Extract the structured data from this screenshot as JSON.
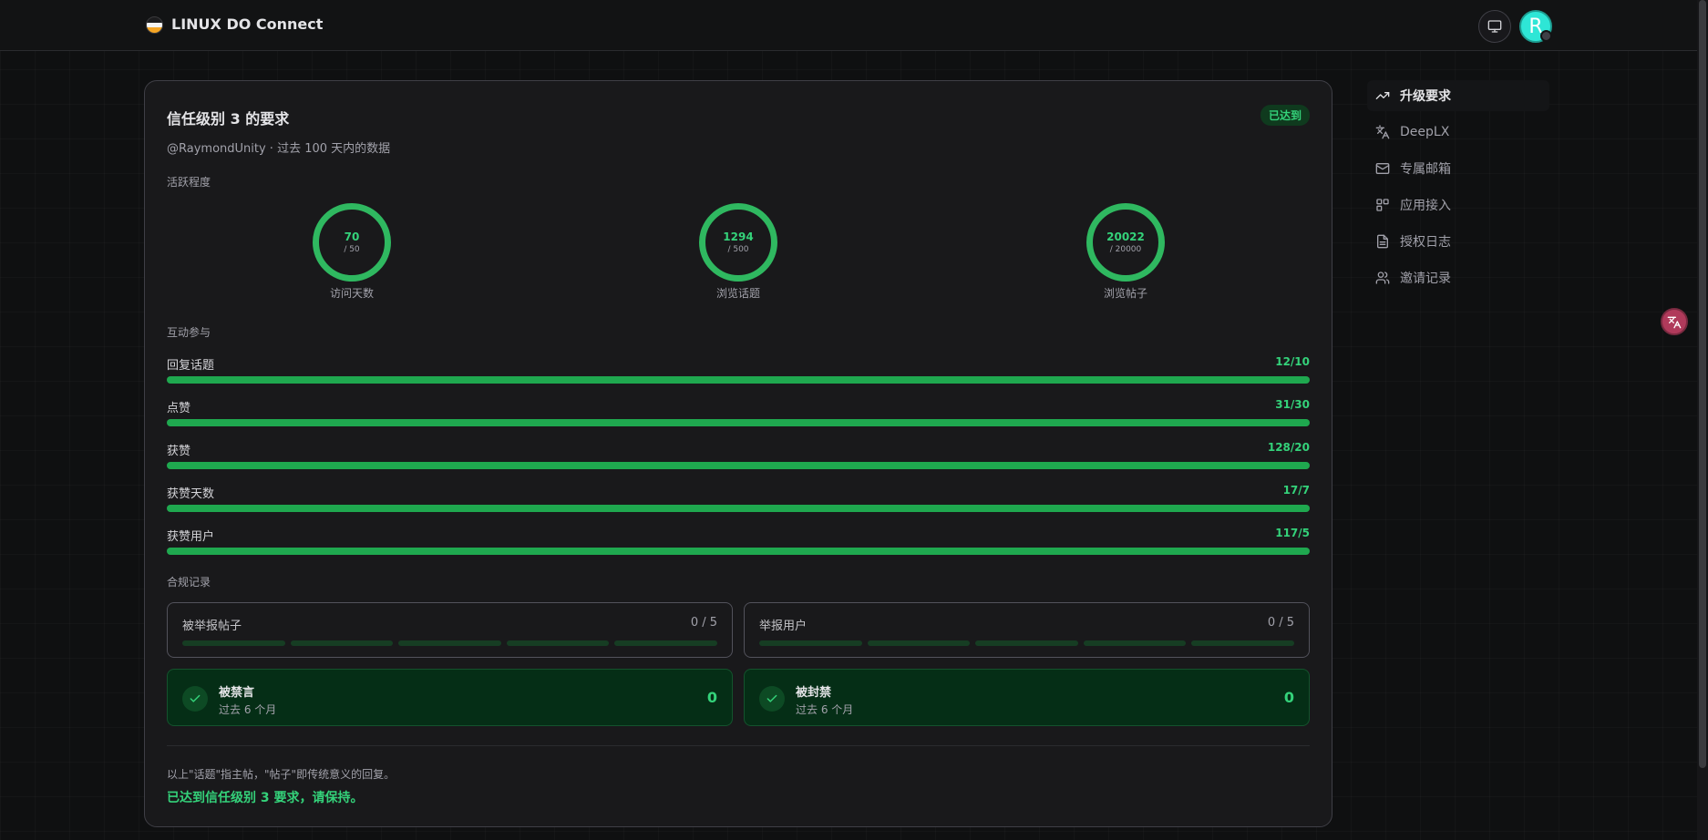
{
  "header": {
    "brand": "LINUX DO Connect",
    "avatar_letter": "R"
  },
  "card": {
    "title": "信任级别 3 的要求",
    "badge": "已达到",
    "subtitle": "@RaymondUnity · 过去 100 天内的数据",
    "activity": {
      "heading": "活跃程度",
      "rings": [
        {
          "value": "70",
          "target": "/ 50",
          "label": "访问天数"
        },
        {
          "value": "1294",
          "target": "/ 500",
          "label": "浏览话题"
        },
        {
          "value": "20022",
          "target": "/ 20000",
          "label": "浏览帖子"
        }
      ]
    },
    "interaction": {
      "heading": "互动参与",
      "bars": [
        {
          "label": "回复话题",
          "value": "12/10",
          "progress": 1.0
        },
        {
          "label": "点赞",
          "value": "31/30",
          "progress": 1.0
        },
        {
          "label": "获赞",
          "value": "128/20",
          "progress": 1.0
        },
        {
          "label": "获赞天数",
          "value": "17/7",
          "progress": 1.0
        },
        {
          "label": "获赞用户",
          "value": "117/5",
          "progress": 1.0
        }
      ]
    },
    "compliance": {
      "heading": "合规记录",
      "reports": [
        {
          "label": "被举报帖子",
          "value": "0 / 5"
        },
        {
          "label": "举报用户",
          "value": "0 / 5"
        }
      ],
      "bans": [
        {
          "title": "被禁言",
          "sub": "过去 6 个月",
          "count": "0"
        },
        {
          "title": "被封禁",
          "sub": "过去 6 个月",
          "count": "0"
        }
      ]
    },
    "note": "以上\"话题\"指主帖，\"帖子\"即传统意义的回复。",
    "conclusion": "已达到信任级别 3 要求，请保持。"
  },
  "sidebar": {
    "items": [
      {
        "label": "升级要求",
        "icon": "trending-up-icon",
        "active": true
      },
      {
        "label": "DeepLX",
        "icon": "translate-icon",
        "active": false
      },
      {
        "label": "专属邮箱",
        "icon": "mail-icon",
        "active": false
      },
      {
        "label": "应用接入",
        "icon": "apps-icon",
        "active": false
      },
      {
        "label": "授权日志",
        "icon": "file-text-icon",
        "active": false
      },
      {
        "label": "邀请记录",
        "icon": "users-icon",
        "active": false
      }
    ]
  },
  "colors": {
    "accent": "#34d27a",
    "ring": "#2fb860",
    "bar": "#1fa84f",
    "ok_bg": "#052e16"
  }
}
